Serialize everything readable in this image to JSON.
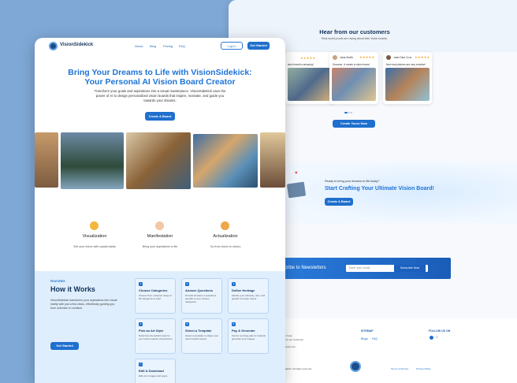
{
  "nav": {
    "brand": "VisionSidekick",
    "links": [
      "About",
      "Blog",
      "Pricing",
      "FAQ"
    ],
    "login": "Log In",
    "get_started": "Get Started"
  },
  "hero": {
    "title_line1": "Bring Your Dreams to Life with VisionSidekick:",
    "title_line2": "Your Personal AI Vision Board Creator",
    "subtitle": "Transform your goals and aspirations into a visual masterpiece. VisionSidekick uses the power of AI to design personalized vision boards that inspire, motivate, and guide you towards your dreams.",
    "cta": "Create A Board"
  },
  "features": [
    {
      "title": "Visualization",
      "desc": "See your future with crystal clarity",
      "icon": "lightbulb-icon"
    },
    {
      "title": "Manifestation",
      "desc": "Bring your aspirations to life",
      "icon": "praying-hands-icon"
    },
    {
      "title": "Actualization",
      "desc": "Go from vision to victory",
      "icon": "rocket-icon"
    }
  ],
  "how": {
    "eyebrow": "FEATURES",
    "title": "How it Works",
    "desc": "VisionSidekick transforms your aspirations into visual reality with just a few clicks, effortlessly guiding you from selection to creation.",
    "cta": "Get Started",
    "steps": [
      {
        "n": "1",
        "title": "Choose Categories",
        "desc": "Choose from a diverse range of 20 categories to start."
      },
      {
        "n": "2",
        "title": "Answer Questions",
        "desc": "Provide answers to questions specific to your chosen categories."
      },
      {
        "n": "3",
        "title": "Define Heritage",
        "desc": "Identify your ethnicity, race, and gender for better output"
      },
      {
        "n": "4",
        "title": "Pick an Art Style",
        "desc": "Determine the artistic style for your vision board's visual theme."
      },
      {
        "n": "5",
        "title": "Select a Template",
        "desc": "Select a template to shape your vision board's layout."
      },
      {
        "n": "6",
        "title": "Pay & Generate",
        "desc": "Opt for a pricing plan to instantly generate your images."
      },
      {
        "n": "7",
        "title": "Edit & Download",
        "desc": "Edit your images and apply..."
      }
    ]
  },
  "testimonials": {
    "title": "Hear from our customers",
    "subtitle": "Real-world proofs are raving about their vision boards.",
    "cards": [
      {
        "name": "",
        "quote": "ision board is amazing!",
        "stars": "★★★★★"
      },
      {
        "name": "Jana Smith",
        "quote": "Success. U create a vision board",
        "stars": "★★★★★"
      },
      {
        "name": "Juan Diaz Cruz",
        "quote": "New real pictures are very creative!",
        "stars": "★★★★★"
      }
    ],
    "cta": "Create Yours Now"
  },
  "cta_band": {
    "eyebrow": "Ready to bring your dreams to life today?",
    "title": "Start Crafting Your Ultimate Vision Board!",
    "button": "Create A Board"
  },
  "newsletter": {
    "label": "scribe to Newsletters",
    "placeholder": "Enter your email",
    "button": "Subscribe Now"
  },
  "footer": {
    "sitemap_title": "SITEMAP",
    "sitemap_links": [
      "Blogs",
      "FAQ"
    ],
    "follow_title": "FOLLOW US ON",
    "contact_lines": [
      "...onal or have",
      "...ached to our Customer",
      "...at",
      "...onsidekick.com"
    ],
    "copyright": "...ionSidekick. All rights reserved",
    "terms": "Terms of Service",
    "privacy": "Privacy Policy"
  },
  "colors": {
    "brand_blue": "#1f73d6",
    "button_blue": "#1f6fce",
    "light_blue_bg": "#dfeefc",
    "star": "#f6a623"
  }
}
